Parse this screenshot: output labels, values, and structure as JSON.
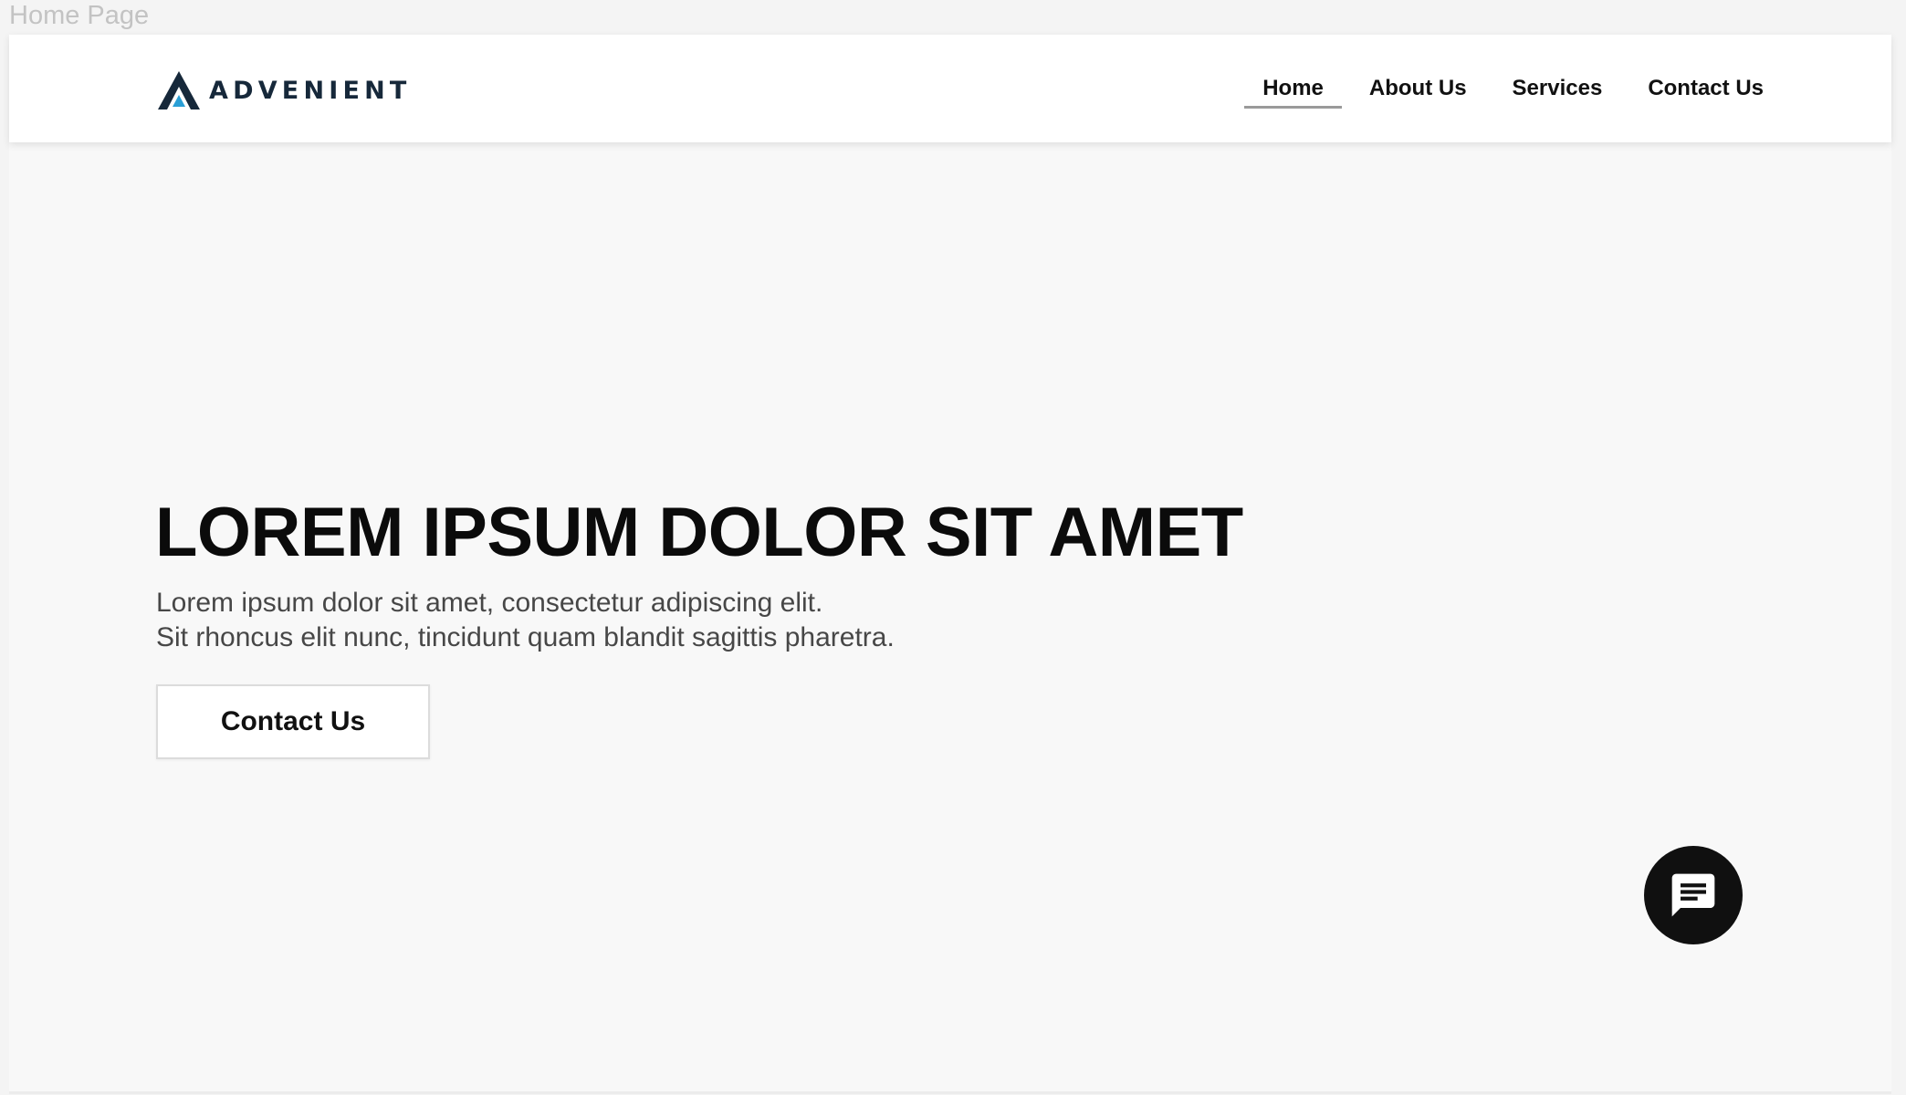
{
  "frame": {
    "label": "Home Page"
  },
  "header": {
    "logo_text": "ADVENIENT",
    "nav": [
      {
        "label": "Home",
        "active": true
      },
      {
        "label": "About Us",
        "active": false
      },
      {
        "label": "Services",
        "active": false
      },
      {
        "label": "Contact Us",
        "active": false
      }
    ]
  },
  "hero": {
    "title": "LOREM IPSUM DOLOR SIT AMET",
    "subtitle_line1": "Lorem ipsum dolor sit amet, consectetur adipiscing elit.",
    "subtitle_line2": "Sit rhoncus elit nunc, tincidunt quam blandit sagittis pharetra.",
    "cta_label": "Contact Us"
  },
  "chat": {
    "icon": "chat-message-icon"
  },
  "colors": {
    "brand_dark": "#16283a",
    "brand_accent": "#2a9fd6",
    "nav_underline": "#9a9a9a",
    "fab": "#101010"
  }
}
